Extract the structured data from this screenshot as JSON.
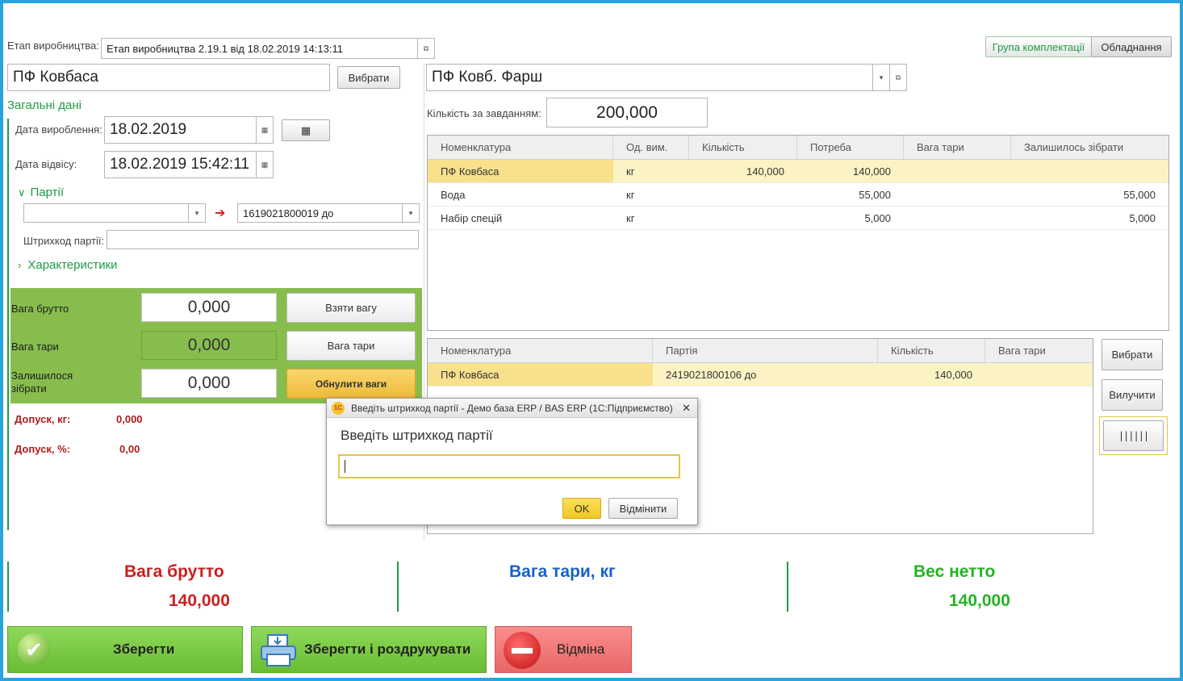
{
  "header": {
    "stage_label": "Етап виробництва:",
    "stage_value": "Етап виробництва 2.19.1 від 18.02.2019 14:13:11",
    "tabs": [
      "Група комплектації",
      "Обладнання"
    ]
  },
  "product": {
    "value": "ПФ Ковбаса",
    "select_button": "Вибрати"
  },
  "general": {
    "title": "Загальні дані",
    "production_date_label": "Дата вироблення:",
    "production_date": "18.02.2019",
    "dispatch_date_label": "Дата відвісу:",
    "dispatch_date": "18.02.2019 15:42:11"
  },
  "batches": {
    "title": "Партії",
    "from_value": "",
    "to_value": "1619021800019 до",
    "barcode_label": "Штрихкод партії:",
    "barcode_value": "",
    "characteristics_title": "Характеристики"
  },
  "weights": {
    "gross_label": "Вага брутто",
    "gross_value": "0,000",
    "take_weight_button": "Взяти вагу",
    "tare_label": "Вага тари",
    "tare_value": "0,000",
    "tare_button": "Вага тари",
    "remaining_label_line1": "Залишилося",
    "remaining_label_line2": "зібрати",
    "remaining_value": "0,000",
    "reset_button": "Обнулити ваги"
  },
  "tolerance": {
    "kg_label": "Допуск, кг:",
    "kg_value": "0,000",
    "pct_label": "Допуск, %:",
    "pct_value": "0,00"
  },
  "recipe": {
    "value": "ПФ Ковб. Фарш",
    "qty_label": "Кількість за завданням:",
    "qty_value": "200,000"
  },
  "top_table": {
    "headers": [
      "Номенклатура",
      "Од. вим.",
      "Кількість",
      "Потреба",
      "Вага тари",
      "Залишилось зібрати"
    ],
    "rows": [
      [
        "ПФ Ковбаса",
        "кг",
        "140,000",
        "140,000",
        "",
        ""
      ],
      [
        "Вода",
        "кг",
        "",
        "55,000",
        "",
        "55,000"
      ],
      [
        "Набір спецій",
        "кг",
        "",
        "5,000",
        "",
        "5,000"
      ]
    ]
  },
  "bottom_table": {
    "headers": [
      "Номенклатура",
      "Партія",
      "Кількість",
      "Вага тари"
    ],
    "rows": [
      [
        "ПФ Ковбаса",
        "2419021800106 до",
        "140,000",
        ""
      ]
    ]
  },
  "side_buttons": {
    "select": "Вибрати",
    "exclude": "Вилучити"
  },
  "dialog": {
    "title": "Введіть штрихкод партії - Демо база ERP / BAS ERP  (1С:Підприємство)",
    "prompt": "Введіть штрихкод партії",
    "input_value": "",
    "ok": "OK",
    "cancel": "Відмінити"
  },
  "summary": {
    "gross_title": "Вага брутто",
    "gross_value": "140,000",
    "tare_title": "Вага тари, кг",
    "tare_value": "",
    "net_title": "Вес нетто",
    "net_value": "140,000"
  },
  "actions": {
    "save": "Зберегти",
    "save_print": "Зберегти і роздрукувати",
    "cancel": "Відміна"
  },
  "colors": {
    "frame": "#27a3dd",
    "accent_green": "#1f9b45",
    "panel_green": "#87bd4d",
    "gross_red": "#cc1f1f",
    "tare_blue": "#1763c7",
    "net_green": "#23b323"
  }
}
